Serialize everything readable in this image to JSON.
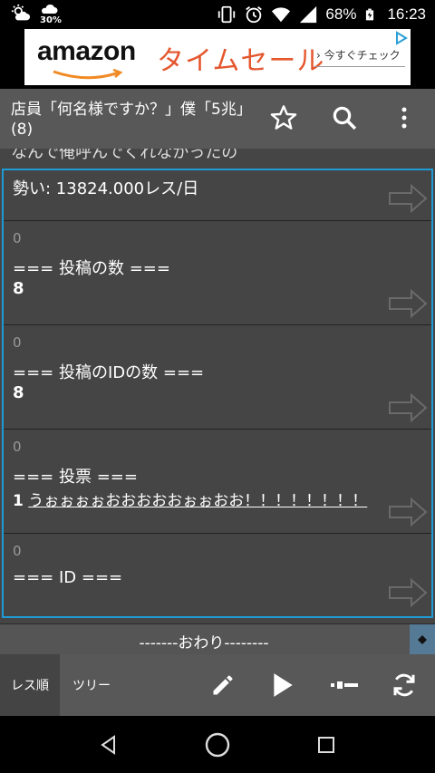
{
  "statusbar": {
    "precip_percent": "30%",
    "battery": "68%",
    "time": "16:23"
  },
  "ad": {
    "brand": "amazon",
    "headline": "タイムセール",
    "cta": "› 今すぐチェック"
  },
  "toolbar": {
    "title": "店員「何名様ですか？」僕「5兆」(8)"
  },
  "content": {
    "partial_line": "なんで俺呼んでくれなかったの",
    "momentum": "勢い: 13824.000レス/日",
    "posts": [
      {
        "num": "0",
        "heading": "=== 投稿の数 ===",
        "value": "8"
      },
      {
        "num": "0",
        "heading": "=== 投稿のIDの数 ===",
        "value": "8"
      },
      {
        "num": "0",
        "heading": "=== 投票 ===",
        "value": "1",
        "vote_text": "うぉぉぉぉおおおおおぉぉおお！！！！！！！！"
      },
      {
        "num": "0",
        "heading": "=== ID ==="
      }
    ],
    "end_marker": "-------おわり--------"
  },
  "bottombar": {
    "tab_order": "レス順",
    "tab_tree": "ツリー"
  },
  "colors": {
    "accent": "#1e9bd7",
    "toolbar": "#585858",
    "content_bg": "#454545"
  }
}
